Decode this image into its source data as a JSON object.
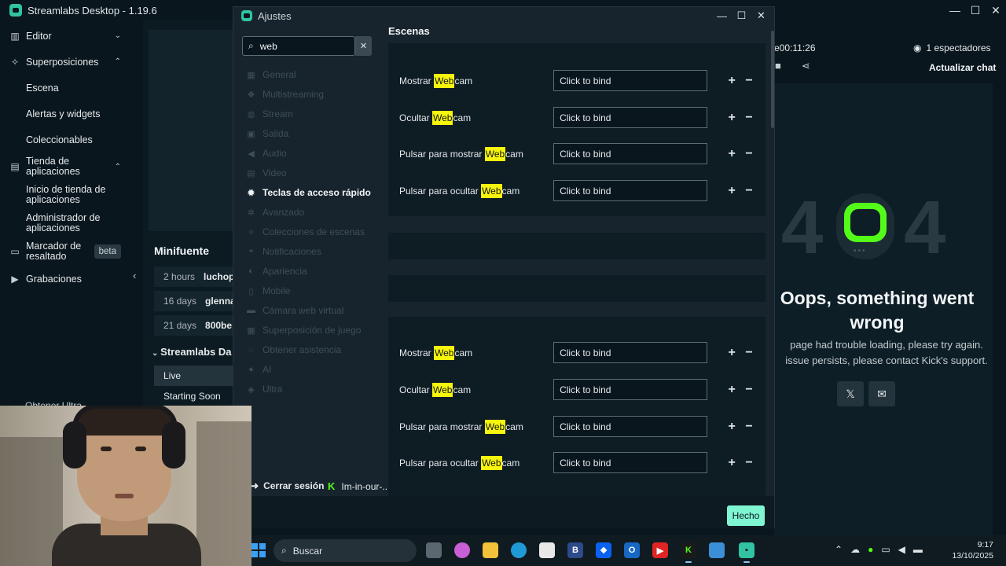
{
  "app": {
    "title": "Streamlabs Desktop - 1.19.6",
    "controls": {
      "minimize": "—",
      "maximize": "☐",
      "close": "✕"
    }
  },
  "sidebar": {
    "editor": "Editor",
    "overlays": "Superposiciones",
    "overlay_items": [
      "Escena",
      "Alertas y widgets",
      "Coleccionables"
    ],
    "app_store": "Tienda de aplicaciones",
    "app_store_items": [
      "Inicio de tienda de aplicaciones",
      "Administrador de aplicaciones"
    ],
    "highlighter": "Marcador de resaltado",
    "beta": "beta",
    "recordings": "Grabaciones",
    "get_ultra": "Obtener Ultra"
  },
  "dock": {
    "minifuente": "Minifuente",
    "recent": [
      {
        "time": "2 hours",
        "user": "luchop"
      },
      {
        "time": "16 days",
        "user": "glenna"
      },
      {
        "time": "21 days",
        "user": "800be"
      }
    ],
    "dashboard": "Streamlabs Da",
    "scenes": [
      "Live",
      "Starting Soon"
    ]
  },
  "chat": {
    "timer": "e00:11:26",
    "viewers": "1 espectadores",
    "refresh": "Actualizar chat",
    "error_code_left": "4",
    "error_code_right": "4",
    "error_title": "Oops, something went wrong",
    "error_sub": "page had trouble loading, please try again. issue persists, please contact Kick's support.",
    "social_x": "𝕏",
    "social_mail": "✉"
  },
  "settings": {
    "title": "Ajustes",
    "search_value": "web",
    "categories": [
      "General",
      "Multistreaming",
      "Stream",
      "Salida",
      "Audio",
      "Video",
      "Teclas de acceso rápido",
      "Avanzado",
      "Colecciones de escenas",
      "Notificaciones",
      "Apariencia",
      "Mobile",
      "Cámara web virtual",
      "Superposición de juego",
      "Obtener asistencia",
      "AI",
      "Ultra"
    ],
    "active_category": "Teclas de acceso rápido",
    "logout": "Cerrar sesión",
    "account": "Im-in-our-...",
    "section_title": "Escenas",
    "highlight": "Web",
    "hotkeys_a": [
      {
        "pre": "Mostrar ",
        "post": "cam",
        "bind": "Click to bind"
      },
      {
        "pre": "Ocultar ",
        "post": "cam",
        "bind": "Click to bind"
      },
      {
        "pre": "Pulsar para mostrar ",
        "post": "cam",
        "bind": "Click to bind"
      },
      {
        "pre": "Pulsar para ocultar ",
        "post": "cam",
        "bind": "Click to bind"
      }
    ],
    "hotkeys_b": [
      {
        "pre": "Mostrar ",
        "post": "cam",
        "bind": "Click to bind"
      },
      {
        "pre": "Ocultar ",
        "post": "cam",
        "bind": "Click to bind"
      },
      {
        "pre": "Pulsar para mostrar ",
        "post": "cam",
        "bind": "Click to bind"
      },
      {
        "pre": "Pulsar para ocultar ",
        "post": "cam",
        "bind": "Click to bind"
      }
    ],
    "done": "Hecho"
  },
  "taskbar": {
    "search": "Buscar",
    "time": "9:17",
    "date": "13/10/2025"
  },
  "colors": {
    "accent": "#80f5d2",
    "highlight": "#f5f50d",
    "kick_green": "#53fc18"
  }
}
